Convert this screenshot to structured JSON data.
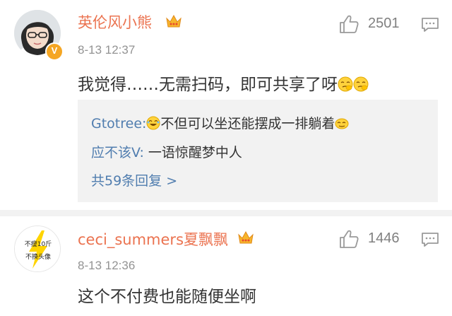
{
  "comments": [
    {
      "username": "英伦风小熊",
      "time": "8-13 12:37",
      "likes": "2501",
      "text": "我觉得……无需扫码，即可共享了呀",
      "replies": [
        {
          "name": "Gtotree:",
          "text": "不但可以坐还能摆成一排躺着"
        },
        {
          "name": "应不该V:",
          "text": " 一语惊醒梦中人"
        }
      ],
      "more_replies": "共59条回复 >"
    },
    {
      "username": "ceci_summers夏飘飘",
      "time": "8-13 12:36",
      "likes": "1446",
      "text": "这个不付费也能随便坐啊",
      "avatar_text": [
        "不瘦10斤",
        "不换头像"
      ]
    }
  ],
  "colors": {
    "username": "#eb7350",
    "link": "#507daf",
    "meta": "#939393",
    "reply_bg": "#f2f2f2",
    "verified_badge": "#f5a623"
  },
  "icons": [
    "crown-icon",
    "thumbs-up-icon",
    "comment-icon",
    "verified-icon",
    "emoji-icon"
  ]
}
